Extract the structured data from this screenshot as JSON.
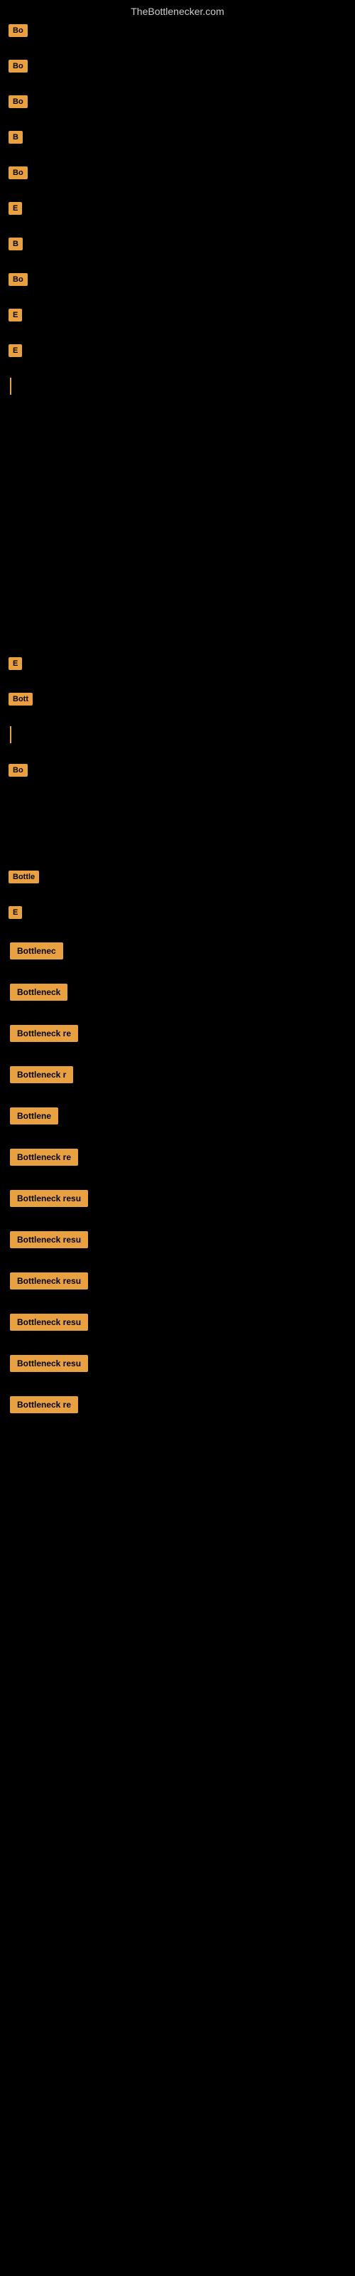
{
  "site": {
    "title": "TheBottlenecker.com"
  },
  "rows": [
    {
      "label": "Bo",
      "type": "orange-btn"
    },
    {
      "label": "Bo",
      "type": "orange-btn"
    },
    {
      "label": "Bo",
      "type": "orange-btn"
    },
    {
      "label": "B",
      "type": "orange-btn"
    },
    {
      "label": "Bo",
      "type": "orange-btn"
    },
    {
      "label": "E",
      "type": "orange-btn"
    },
    {
      "label": "B",
      "type": "orange-btn"
    },
    {
      "label": "Bo",
      "type": "orange-btn"
    },
    {
      "label": "E",
      "type": "orange-btn"
    },
    {
      "label": "E",
      "type": "orange-btn"
    },
    {
      "label": "|",
      "type": "vline"
    }
  ],
  "bottom_rows": [
    {
      "label": "E",
      "type": "orange-btn"
    },
    {
      "label": "Bott",
      "type": "orange-btn"
    },
    {
      "label": "|",
      "type": "vline"
    },
    {
      "label": "Bo",
      "type": "orange-btn"
    }
  ],
  "final_rows": [
    {
      "label": "Bottle",
      "type": "orange-btn"
    },
    {
      "label": "E",
      "type": "orange-btn"
    },
    {
      "label": "Bottlenec",
      "type": "orange-btn"
    },
    {
      "label": "Bottleneck",
      "type": "orange-btn"
    },
    {
      "label": "Bottleneck re",
      "type": "orange-btn"
    },
    {
      "label": "Bottleneck r",
      "type": "orange-btn"
    },
    {
      "label": "Bottlene",
      "type": "orange-btn"
    },
    {
      "label": "Bottleneck re",
      "type": "orange-btn"
    },
    {
      "label": "Bottleneck resu",
      "type": "orange-btn"
    },
    {
      "label": "Bottleneck resu",
      "type": "orange-btn"
    },
    {
      "label": "Bottleneck resu",
      "type": "orange-btn"
    },
    {
      "label": "Bottleneck resu",
      "type": "orange-btn"
    },
    {
      "label": "Bottleneck resu",
      "type": "orange-btn"
    },
    {
      "label": "Bottleneck re",
      "type": "orange-btn"
    }
  ]
}
